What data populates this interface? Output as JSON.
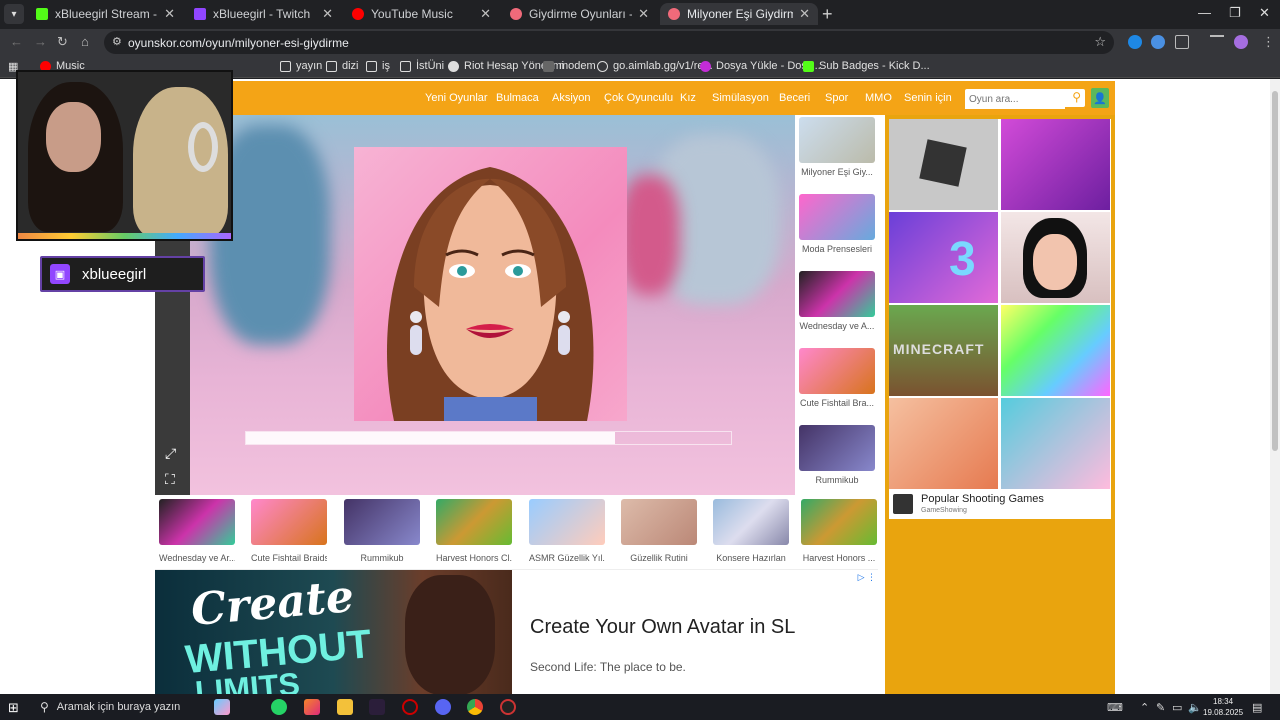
{
  "browser": {
    "tabs": [
      {
        "title": "xBlueegirl Stream - Watch Live",
        "favicon_color": "#53fc18",
        "active": false
      },
      {
        "title": "xBlueegirl - Twitch",
        "favicon_color": "#9146ff",
        "active": false
      },
      {
        "title": "YouTube Music",
        "favicon_color": "#ff0000",
        "active": false
      },
      {
        "title": "Giydirme Oyunları - Oyunskor'd",
        "favicon_color": "#f06a7a",
        "active": false
      },
      {
        "title": "Milyoner Eşi Giydirme - Oyunsk",
        "favicon_color": "#f06a7a",
        "active": true
      }
    ],
    "url": "oyunskor.com/oyun/milyoner-esi-giydirme",
    "bookmarks": [
      {
        "label": "Music",
        "color": "#ff0000"
      },
      {
        "label": "yayın",
        "color": "#ddd"
      },
      {
        "label": "dizi",
        "color": "#ddd"
      },
      {
        "label": "iş",
        "color": "#ddd"
      },
      {
        "label": "İstÜni",
        "color": "#ddd"
      },
      {
        "label": "Riot Hesap Yönetimi",
        "color": "#e0e0e0"
      },
      {
        "label": "modem",
        "color": "#999"
      },
      {
        "label": "go.aimlab.gg/v1/re...",
        "color": "#ddd"
      },
      {
        "label": "Dosya Yükle - Dosy...",
        "color": "#c32cd6"
      },
      {
        "label": "Sub Badges - Kick D...",
        "color": "#53fc18"
      }
    ]
  },
  "site": {
    "nav": [
      "Yeni Oyunlar",
      "Bulmaca",
      "Aksiyon",
      "Çok Oyunculu",
      "Kız",
      "Simülasyon",
      "Beceri",
      "Spor",
      "MMO",
      "Senin için"
    ],
    "search_placeholder": "Oyun ara...",
    "accent": "#f4a416",
    "loading_progress": 0.76,
    "side_games": [
      "Milyoner Eşi Giy...",
      "Moda Prensesleri",
      "Wednesday ve A...",
      "Cute Fishtail Bra...",
      "Rummikub"
    ],
    "bottom_games": [
      "Wednesday ve Ar...",
      "Cute Fishtail Braids",
      "Rummikub",
      "Harvest Honors Cl...",
      "ASMR Güzellik Yıl...",
      "Güzellik Rutini",
      "Konsere Hazırlan",
      "Harvest Honors ..."
    ],
    "ad_right": {
      "title": "Popular Shooting Games",
      "source": "GameShowing",
      "tile_text": "MINECRAFT"
    },
    "banner": {
      "line1": "Create",
      "line2": "WITHOUT",
      "line3": "LIMITS",
      "headline": "Create Your Own Avatar in SL",
      "sub": "Second Life: The place to be."
    }
  },
  "overlay": {
    "streamer": "xblueegirl"
  },
  "taskbar": {
    "search_placeholder": "Aramak için buraya yazın",
    "time": "18:34",
    "date": "19.08.2025"
  }
}
